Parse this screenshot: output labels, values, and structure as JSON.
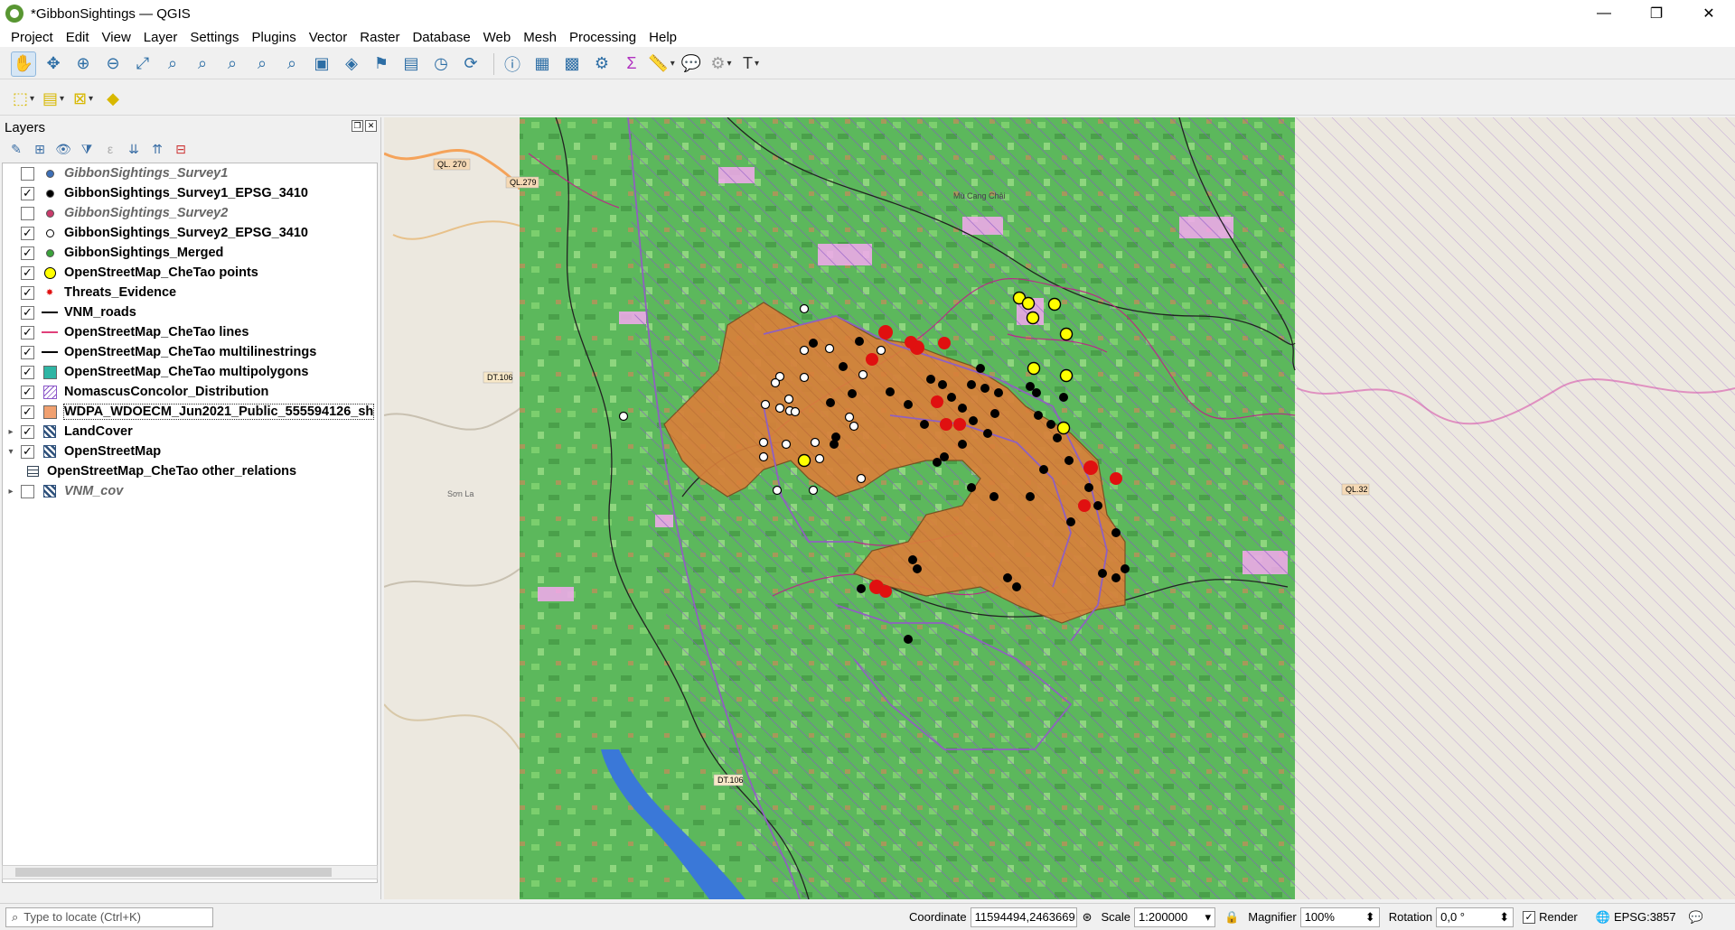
{
  "window": {
    "title": "*GibbonSightings — QGIS",
    "controls": [
      "—",
      "❐",
      "✕"
    ]
  },
  "menu": [
    "Project",
    "Edit",
    "View",
    "Layer",
    "Settings",
    "Plugins",
    "Vector",
    "Raster",
    "Database",
    "Web",
    "Mesh",
    "Processing",
    "Help"
  ],
  "layers_panel": {
    "title": "Layers",
    "items": [
      {
        "label": "GibbonSightings_Survey1",
        "checked": false,
        "symbol": "point",
        "color": "#3d6fb6",
        "fill": true
      },
      {
        "label": "GibbonSightings_Survey1_EPSG_3410",
        "checked": true,
        "symbol": "point",
        "color": "#000000",
        "fill": true
      },
      {
        "label": "GibbonSightings_Survey2",
        "checked": false,
        "symbol": "point",
        "color": "#c93b6b",
        "fill": true
      },
      {
        "label": "GibbonSightings_Survey2_EPSG_3410",
        "checked": true,
        "symbol": "point",
        "color": "#000000",
        "fill": false
      },
      {
        "label": "GibbonSightings_Merged",
        "checked": true,
        "symbol": "point",
        "color": "#3aa23a",
        "fill": true
      },
      {
        "label": "OpenStreetMap_CheTao points",
        "checked": true,
        "symbol": "bigpoint",
        "color": "#ffff00",
        "fill": true
      },
      {
        "label": "Threats_Evidence",
        "checked": true,
        "symbol": "star",
        "color": "#e01010",
        "fill": true
      },
      {
        "label": "VNM_roads",
        "checked": true,
        "symbol": "line",
        "color": "#000000"
      },
      {
        "label": "OpenStreetMap_CheTao lines",
        "checked": true,
        "symbol": "line",
        "color": "#e0407a"
      },
      {
        "label": "OpenStreetMap_CheTao multilinestrings",
        "checked": true,
        "symbol": "line",
        "color": "#000000"
      },
      {
        "label": "OpenStreetMap_CheTao multipolygons",
        "checked": true,
        "symbol": "poly",
        "color": "#2fb5a4"
      },
      {
        "label": "NomascusConcolor_Distribution",
        "checked": true,
        "symbol": "hatch",
        "color": "#8a55c8"
      },
      {
        "label": "WDPA_WDOECM_Jun2021_Public_555594126_sh",
        "checked": true,
        "symbol": "poly",
        "color": "#f0a070",
        "selected": true
      },
      {
        "label": "LandCover",
        "checked": true,
        "symbol": "raster",
        "expand": "▸"
      },
      {
        "label": "OpenStreetMap",
        "checked": true,
        "symbol": "raster",
        "expand": "▾"
      },
      {
        "label": "OpenStreetMap_CheTao other_relations",
        "checked": null,
        "symbol": "table"
      },
      {
        "label": "VNM_cov",
        "checked": false,
        "symbol": "raster",
        "expand": "▸",
        "italic": true
      }
    ]
  },
  "map_labels": {
    "ql270": "QL. 270",
    "ql279": "QL.279",
    "dt106a": "DT.106",
    "dt106b": "DT.106",
    "sonla": "Sơn La",
    "mucangchai": "Mù Cang Chải",
    "ql32": "QL.32"
  },
  "status": {
    "locate_placeholder": "Type to locate (Ctrl+K)",
    "coordinate_label": "Coordinate",
    "coordinate_value": "11594494,2463669",
    "scale_label": "Scale",
    "scale_value": "1:200000",
    "magnifier_label": "Magnifier",
    "magnifier_value": "100%",
    "rotation_label": "Rotation",
    "rotation_value": "0,0 °",
    "render_label": "Render",
    "crs": "EPSG:3857"
  },
  "icons": [
    "pan-icon",
    "zoom-in-icon",
    "zoom-out-icon",
    "identify-icon",
    "sum-icon",
    "measure-icon",
    "text-annotation-icon",
    "select-icon"
  ]
}
